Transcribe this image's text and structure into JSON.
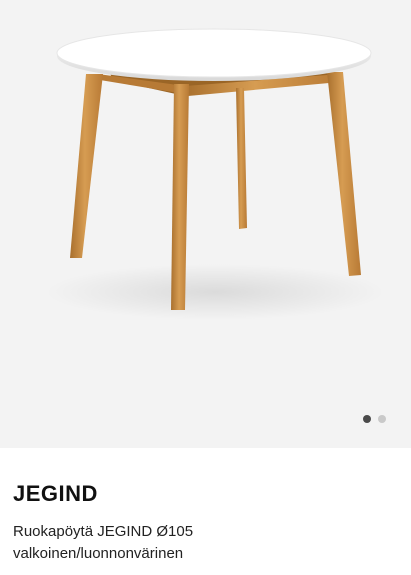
{
  "gallery": {
    "image_alt": "Ruokapöytä JEGIND Ø105 valkoinen/luonnonvärinen",
    "image_count": 2,
    "active_index": 0
  },
  "product": {
    "brand": "JEGIND",
    "description_line1": "Ruokapöytä JEGIND Ø105",
    "description_line2": "valkoinen/luonnonvärinen"
  },
  "colors": {
    "gallery_bg": "#f3f3f3",
    "tabletop": "#ffffff",
    "wood": "#c98f44",
    "dot_active": "#4a4a4a",
    "dot_inactive": "#c9c9c9"
  }
}
